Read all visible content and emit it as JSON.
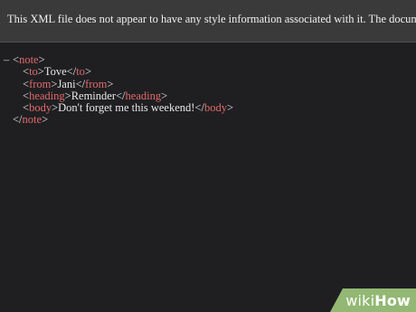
{
  "info_bar": {
    "text": "This XML file does not appear to have any style information associated with it. The document tree is shown below."
  },
  "xml": {
    "toggle": "–",
    "lt": "<",
    "gt": ">",
    "lt_close": "</",
    "root_tag": "note",
    "children": [
      {
        "tag": "to",
        "content": "Tove"
      },
      {
        "tag": "from",
        "content": "Jani"
      },
      {
        "tag": "heading",
        "content": "Reminder"
      },
      {
        "tag": "body",
        "content": "Don't forget me this weekend!"
      }
    ]
  },
  "watermark": {
    "wiki": "wiki",
    "how": "How",
    "color": "#93b874"
  }
}
